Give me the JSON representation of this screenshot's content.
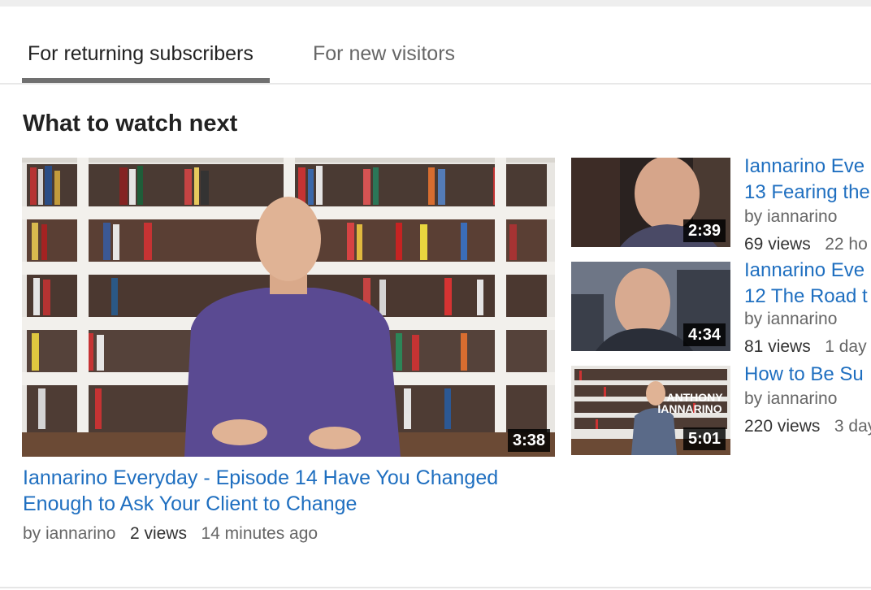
{
  "tabs": [
    {
      "label": "For returning subscribers",
      "active": true
    },
    {
      "label": "For new visitors",
      "active": false
    }
  ],
  "section_title": "What to watch next",
  "featured": {
    "title_line1": "Iannarino Everyday - Episode 14 Have You Changed",
    "title_line2": "Enough to Ask Your Client to Change",
    "duration": "3:38",
    "channel": "by iannarino",
    "views": "2 views",
    "age": "14 minutes ago"
  },
  "side_videos": [
    {
      "title_line1": "Iannarino Eve",
      "title_line2": "13 Fearing the",
      "duration": "2:39",
      "channel": "by iannarino",
      "views": "69 views",
      "age": "22 ho"
    },
    {
      "title_line1": "Iannarino Eve",
      "title_line2": "12 The Road t",
      "duration": "4:34",
      "channel": "by iannarino",
      "views": "81 views",
      "age": "1 day"
    },
    {
      "title_line1": "How to Be Su",
      "duration": "5:01",
      "overlay_line1": "ANTHONY",
      "overlay_line2": "IANNARINO",
      "channel": "by iannarino",
      "views": "220 views",
      "age": "3 day"
    }
  ],
  "colors": {
    "link": "#1f6fc0",
    "tab_underline": "#707070"
  }
}
